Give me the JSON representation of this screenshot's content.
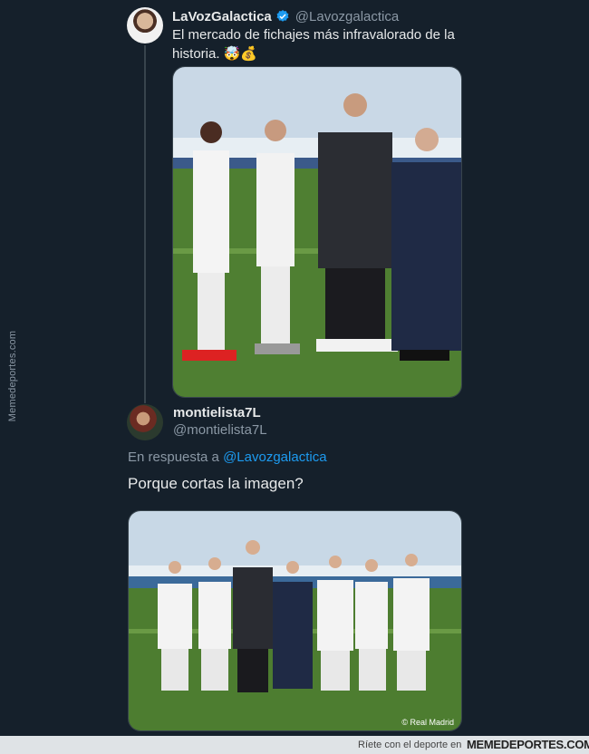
{
  "watermark": {
    "side": "Memedeportes.com"
  },
  "tweet": {
    "author_name": "LaVozGalactica",
    "author_handle": "@Lavozgalactica",
    "text": "El mercado de fichajes más infravalorado de la historia.",
    "emojis": "🤯💰"
  },
  "reply": {
    "author_name": "montielista7L",
    "author_handle": "@montielista7L",
    "reply_prefix": "En respuesta a",
    "reply_to_handle": "@Lavozgalactica",
    "text": "Porque cortas la imagen?",
    "photo_credit": "© Real Madrid"
  },
  "footer": {
    "tagline": "Ríete con el deporte en",
    "brand": "MEMEDEPORTES.COM"
  },
  "colors": {
    "background": "#15202b",
    "link": "#1d9bf0",
    "verified": "#1d9bf0",
    "muted": "#8b98a5"
  }
}
